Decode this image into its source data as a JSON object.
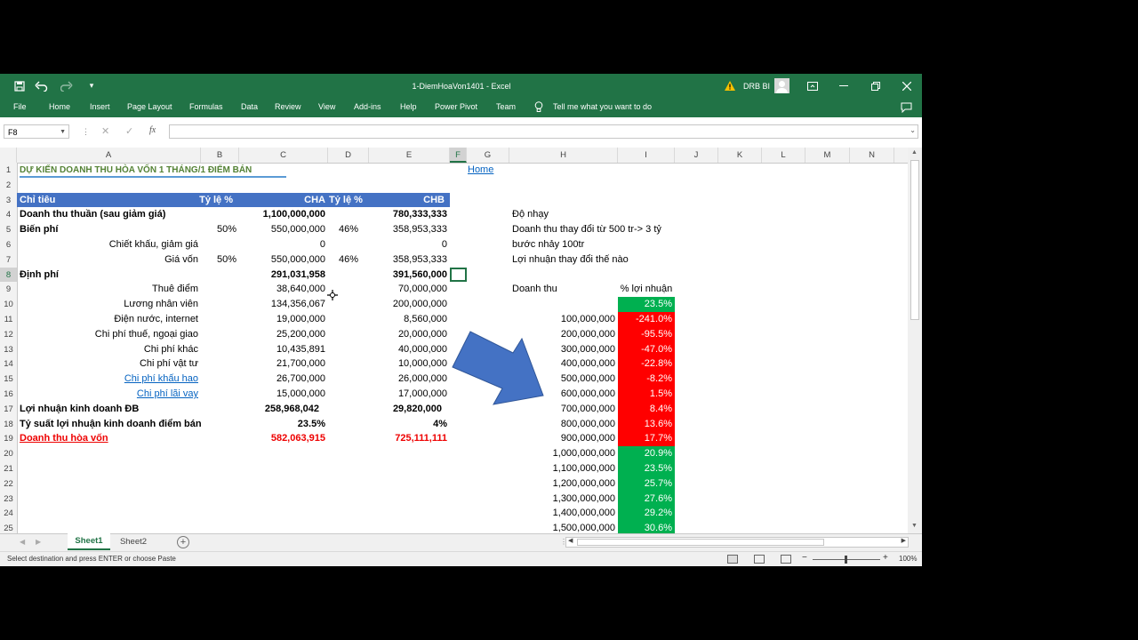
{
  "window": {
    "title": "1-DiemHoaVon1401  -  Excel",
    "user": "DRB BI"
  },
  "ribbon": {
    "tabs": [
      "File",
      "Home",
      "Insert",
      "Page Layout",
      "Formulas",
      "Data",
      "Review",
      "View",
      "Add-ins",
      "Help",
      "Power Pivot",
      "Team"
    ],
    "tell_me": "Tell me what you want to do"
  },
  "formula_bar": {
    "name_box": "F8",
    "formula": ""
  },
  "columns": [
    "A",
    "B",
    "C",
    "D",
    "E",
    "F",
    "G",
    "H",
    "I",
    "J",
    "K",
    "L",
    "M",
    "N"
  ],
  "rows": [
    "1",
    "2",
    "3",
    "4",
    "5",
    "6",
    "7",
    "8",
    "9",
    "10",
    "11",
    "12",
    "13",
    "14",
    "15",
    "16",
    "17",
    "18",
    "19",
    "20",
    "21",
    "22",
    "23",
    "24",
    "25"
  ],
  "sheet": {
    "title": "DỰ KIẾN DOANH THU HÒA VỐN 1 THÁNG/1 ĐIỂM BÁN",
    "home_link": "Home",
    "header": {
      "a": "Chỉ tiêu",
      "b": "Tỷ lệ %",
      "c": "CHA",
      "d": "Tỷ lệ %",
      "e": "CHB"
    },
    "table": [
      {
        "a": "Doanh thu thuần (sau giảm giá)",
        "b": "",
        "c": "1,100,000,000",
        "d": "",
        "e": "780,333,333"
      },
      {
        "a": "Biến phí",
        "b": "50%",
        "c": "550,000,000",
        "d": "46%",
        "e": "358,953,333"
      },
      {
        "a": "Chiết khấu, giảm giá",
        "b": "",
        "c": "0",
        "d": "",
        "e": "0"
      },
      {
        "a": "Giá vốn",
        "b": "50%",
        "c": "550,000,000",
        "d": "46%",
        "e": "358,953,333"
      },
      {
        "a": "Định phí",
        "b": "",
        "c": "291,031,958",
        "d": "",
        "e": "391,560,000"
      },
      {
        "a": "Thuê điểm",
        "b": "",
        "c": "38,640,000",
        "d": "",
        "e": "70,000,000"
      },
      {
        "a": "Lương nhân viên",
        "b": "",
        "c": "134,356,067",
        "d": "",
        "e": "200,000,000"
      },
      {
        "a": "Điện nước, internet",
        "b": "",
        "c": "19,000,000",
        "d": "",
        "e": "8,560,000"
      },
      {
        "a": "Chi phí thuế, ngoại giao",
        "b": "",
        "c": "25,200,000",
        "d": "",
        "e": "20,000,000"
      },
      {
        "a": "Chi phí khác",
        "b": "",
        "c": "10,435,891",
        "d": "",
        "e": "40,000,000"
      },
      {
        "a": "Chi phí vật tư",
        "b": "",
        "c": "21,700,000",
        "d": "",
        "e": "10,000,000"
      },
      {
        "a": "Chi phí khấu hao",
        "b": "",
        "c": "26,700,000",
        "d": "",
        "e": "26,000,000"
      },
      {
        "a": "Chi phí lãi vay",
        "b": "",
        "c": "15,000,000",
        "d": "",
        "e": "17,000,000"
      },
      {
        "a": "Lợi nhuận kinh doanh ĐB",
        "b": "",
        "c": "258,968,042",
        "d": "",
        "e": "29,820,000"
      },
      {
        "a": "Tỷ suất lợi nhuận kinh doanh điểm bán",
        "b": "",
        "c": "23.5%",
        "d": "",
        "e": "4%"
      },
      {
        "a": "Doanh thu hòa vốn",
        "b": "",
        "c": "582,063,915",
        "d": "",
        "e": "725,111,111"
      }
    ],
    "notes": [
      "Độ nhạy",
      "Doanh thu thay đổi từ 500 tr-> 3 tỷ",
      "bước nhảy 100tr",
      "Lợi nhuận thay  đổi thế nào"
    ],
    "sens_header": {
      "h": "Doanh thu",
      "i": "% lợi nhuận"
    },
    "sensitivity": [
      {
        "h": "",
        "i": "23.5%",
        "color": "#00b050"
      },
      {
        "h": "100,000,000",
        "i": "-241.0%",
        "color": "#ff0000"
      },
      {
        "h": "200,000,000",
        "i": "-95.5%",
        "color": "#ff0000"
      },
      {
        "h": "300,000,000",
        "i": "-47.0%",
        "color": "#ff0000"
      },
      {
        "h": "400,000,000",
        "i": "-22.8%",
        "color": "#ff0000"
      },
      {
        "h": "500,000,000",
        "i": "-8.2%",
        "color": "#ff0000"
      },
      {
        "h": "600,000,000",
        "i": "1.5%",
        "color": "#ff0000"
      },
      {
        "h": "700,000,000",
        "i": "8.4%",
        "color": "#ff0000"
      },
      {
        "h": "800,000,000",
        "i": "13.6%",
        "color": "#ff0000"
      },
      {
        "h": "900,000,000",
        "i": "17.7%",
        "color": "#ff0000"
      },
      {
        "h": "1,000,000,000",
        "i": "20.9%",
        "color": "#00b050"
      },
      {
        "h": "1,100,000,000",
        "i": "23.5%",
        "color": "#00b050"
      },
      {
        "h": "1,200,000,000",
        "i": "25.7%",
        "color": "#00b050"
      },
      {
        "h": "1,300,000,000",
        "i": "27.6%",
        "color": "#00b050"
      },
      {
        "h": "1,400,000,000",
        "i": "29.2%",
        "color": "#00b050"
      },
      {
        "h": "1,500,000,000",
        "i": "30.6%",
        "color": "#00b050"
      }
    ]
  },
  "sheets": [
    "Sheet1",
    "Sheet2"
  ],
  "status": {
    "message": "Select destination and press ENTER or choose Paste",
    "zoom": "100%"
  },
  "colors": {
    "excel_green": "#217346",
    "header_blue": "#4472c4",
    "arrow_blue": "#4472c4"
  }
}
